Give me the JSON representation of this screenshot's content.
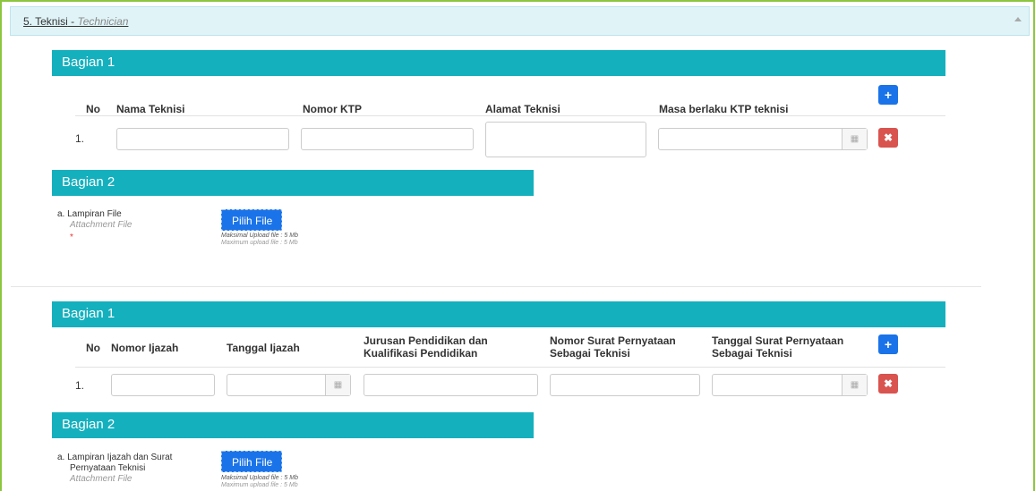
{
  "panel": {
    "title": "5. Teknisi",
    "title_sep": " - ",
    "title_en": "Technician"
  },
  "block1": {
    "section1_title": "Bagian 1",
    "headers": [
      "No",
      "Nama Teknisi",
      "Nomor KTP",
      "Alamat Teknisi",
      "Masa berlaku KTP teknisi"
    ],
    "row_no": "1.",
    "section2_title": "Bagian 2",
    "attachment_label": "a. Lampiran File",
    "attachment_label_en": "Attachment File",
    "required_mark": "*",
    "file_button": "Pilih File",
    "max_upload": "Maksimal Upload file : 5 Mb",
    "max_upload_en": "Maximum upload file : 5 Mb"
  },
  "block2": {
    "section1_title": "Bagian 1",
    "headers": [
      "No",
      "Nomor Ijazah",
      "Tanggal Ijazah",
      "Jurusan Pendidikan dan Kualifikasi Pendidikan",
      "Nomor Surat Pernyataan Sebagai Teknisi",
      "Tanggal Surat Pernyataan Sebagai Teknisi"
    ],
    "row_no": "1.",
    "section2_title": "Bagian 2",
    "attachment_label_line1": "a. Lampiran Ijazah dan Surat",
    "attachment_label_line2": "Pernyataan Teknisi",
    "attachment_label_en": "Attachment File",
    "file_button": "Pilih File",
    "max_upload": "Maksimal Upload file : 5 Mb",
    "max_upload_en": "Maximum upload file : 5 Mb"
  },
  "icons": {
    "add": "plus-icon",
    "remove": "times-icon",
    "calendar": "calendar-icon",
    "collapse": "caret-up-icon"
  },
  "colors": {
    "section_bar": "#14b0be",
    "panel_header": "#e0f4f8",
    "frame_border": "#8cc63f",
    "add_button": "#1a73e8",
    "remove_button": "#d9534f"
  }
}
